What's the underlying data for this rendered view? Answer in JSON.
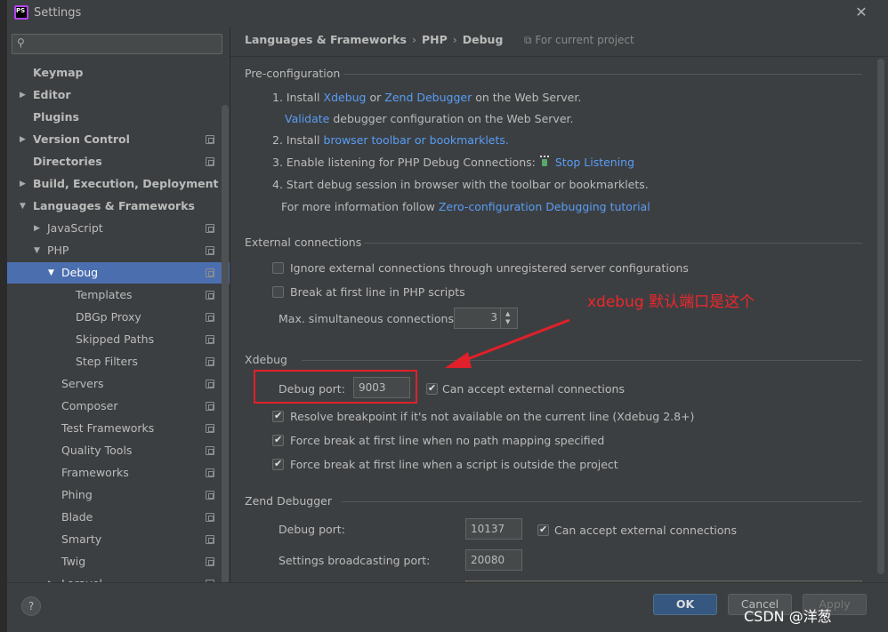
{
  "window": {
    "title": "Settings",
    "app_icon_text": "PS"
  },
  "sidebar": {
    "search_placeholder": "",
    "items": [
      {
        "label": "Keymap"
      },
      {
        "label": "Editor"
      },
      {
        "label": "Plugins"
      },
      {
        "label": "Version Control"
      },
      {
        "label": "Directories"
      },
      {
        "label": "Build, Execution, Deployment"
      },
      {
        "label": "Languages & Frameworks"
      },
      {
        "label": "JavaScript"
      },
      {
        "label": "PHP"
      },
      {
        "label": "Debug"
      },
      {
        "label": "Templates"
      },
      {
        "label": "DBGp Proxy"
      },
      {
        "label": "Skipped Paths"
      },
      {
        "label": "Step Filters"
      },
      {
        "label": "Servers"
      },
      {
        "label": "Composer"
      },
      {
        "label": "Test Frameworks"
      },
      {
        "label": "Quality Tools"
      },
      {
        "label": "Frameworks"
      },
      {
        "label": "Phing"
      },
      {
        "label": "Blade"
      },
      {
        "label": "Smarty"
      },
      {
        "label": "Twig"
      },
      {
        "label": "Laravel"
      }
    ]
  },
  "breadcrumb": {
    "items": [
      "Languages & Frameworks",
      "PHP",
      "Debug"
    ],
    "separator": "›",
    "scope": "For current project"
  },
  "pre_configuration": {
    "title": "Pre-configuration",
    "step1_prefix": "1. Install",
    "step1_link1": "Xdebug",
    "step1_or": "or",
    "step1_link2": "Zend Debugger",
    "step1_suffix": "on the Web Server.",
    "validate_link": "Validate",
    "validate_text": "debugger configuration on the Web Server.",
    "step2_prefix": "2. Install",
    "step2_link": "browser toolbar or bookmarklets.",
    "step3_text": "3. Enable listening for PHP Debug Connections:",
    "step3_link": "Stop Listening",
    "step4_text": "4. Start debug session in browser with the toolbar or bookmarklets.",
    "more_info_text": "For more information follow",
    "more_info_link": "Zero-configuration Debugging tutorial"
  },
  "external_connections": {
    "title": "External connections",
    "ignore_label": "Ignore external connections through unregistered server configurations",
    "ignore_checked": false,
    "break_label": "Break at first line in PHP scripts",
    "break_checked": false,
    "max_label": "Max. simultaneous connections:",
    "max_value": "3"
  },
  "xdebug": {
    "title": "Xdebug",
    "port_label": "Debug port:",
    "port_value": "9003",
    "accept_label": "Can accept external connections",
    "accept_checked": true,
    "resolve_label": "Resolve breakpoint if it's not available on the current line (Xdebug 2.8+)",
    "resolve_checked": true,
    "force_mapping_label": "Force break at first line when no path mapping specified",
    "force_mapping_checked": true,
    "force_outside_label": "Force break at first line when a script is outside the project",
    "force_outside_checked": true
  },
  "zend_debugger": {
    "title": "Zend Debugger",
    "port_label": "Debug port:",
    "port_value": "10137",
    "accept_label": "Can accept external connections",
    "accept_checked": true,
    "broadcast_label": "Settings broadcasting port:",
    "broadcast_value": "20080"
  },
  "annotation": {
    "note": "xdebug 默认端口是这个",
    "color": "#e0202a"
  },
  "footer": {
    "help": "?",
    "ok": "OK",
    "cancel": "Cancel",
    "apply": "Apply"
  },
  "watermark": "CSDN @洋葱",
  "colors": {
    "background": "#3c3f41",
    "selection": "#4b6eaf",
    "link": "#589df6",
    "ok_button": "#365880"
  }
}
